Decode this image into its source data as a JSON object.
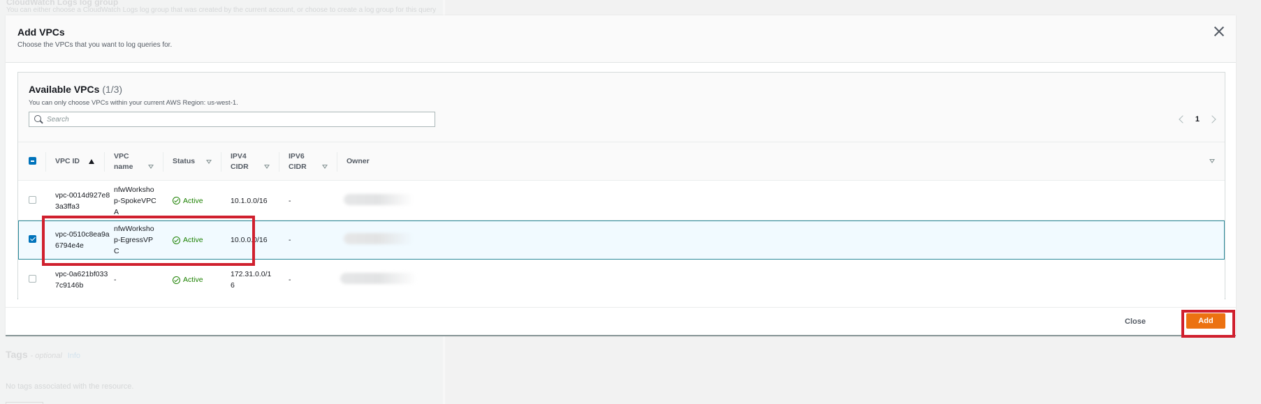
{
  "background": {
    "section_title": "CloudWatch Logs log group",
    "section_desc": "You can either choose a CloudWatch Logs log group that was created by the current account, or choose to create a log group for this query",
    "tags_title": "Tags",
    "tags_optional": "- optional",
    "tags_info": "Info",
    "no_tags": "No tags associated with the resource."
  },
  "modal": {
    "title": "Add VPCs",
    "description": "Choose the VPCs that you want to log queries for.",
    "close_icon": "close-icon"
  },
  "table": {
    "title": "Available VPCs",
    "count": "(1/3)",
    "description": "You can only choose VPCs within your current AWS Region: us-west-1.",
    "search_placeholder": "Search",
    "search_value": "",
    "page": "1",
    "columns": [
      {
        "label": "VPC ID",
        "sort": "ascending"
      },
      {
        "label": "VPC name",
        "sort": "none"
      },
      {
        "label": "Status",
        "sort": "none"
      },
      {
        "label": "IPV4 CIDR",
        "sort": "none"
      },
      {
        "label": "IPV6 CIDR",
        "sort": "none"
      },
      {
        "label": "Owner",
        "sort": "none"
      }
    ],
    "rows": [
      {
        "vpc_id": "vpc-0014d927e83a3ffa3",
        "vpc_name": "nfwWorkshop-SpokeVPCA",
        "status": "Active",
        "ipv4": "10.1.0.0/16",
        "ipv6": "-",
        "owner": "(redacted)",
        "selected": false
      },
      {
        "vpc_id": "vpc-0510c8ea9a6794e4e",
        "vpc_name": "nfwWorkshop-EgressVPC",
        "status": "Active",
        "ipv4": "10.0.0.0/16",
        "ipv6": "-",
        "owner": "(redacted)",
        "selected": true
      },
      {
        "vpc_id": "vpc-0a621bf0337c9146b",
        "vpc_name": "-",
        "status": "Active",
        "ipv4": "172.31.0.0/16",
        "ipv6": "-",
        "owner": "(redacted)",
        "selected": false
      }
    ]
  },
  "footer": {
    "close_label": "Close",
    "add_label": "Add"
  },
  "colors": {
    "primary_button": "#ec7211",
    "selected_row": "#f1faff",
    "checkbox": "#0073bb",
    "status_ok": "#1d8102",
    "annotation": "#d0202e"
  }
}
